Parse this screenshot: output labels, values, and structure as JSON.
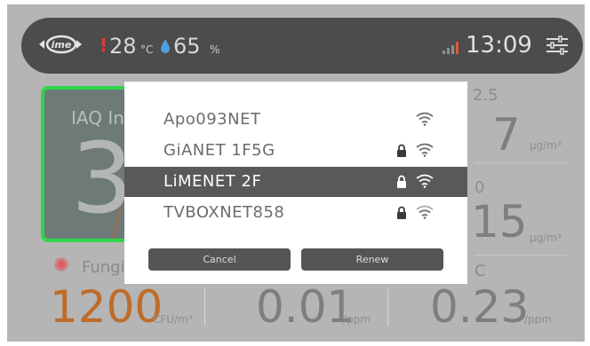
{
  "status_bar": {
    "logo_text": "ime",
    "temperature": "28",
    "temperature_unit": "°C",
    "humidity": "65",
    "humidity_unit": "%",
    "time": "13:09",
    "icons": [
      "lime-logo",
      "thermometer-icon",
      "humidity-drop-icon",
      "signal-icon",
      "settings-sliders-icon"
    ]
  },
  "background": {
    "iaq": {
      "title": "IAQ In",
      "value": "3"
    },
    "pm": {
      "label": "2.5",
      "value": "7",
      "unit": "μg/m³"
    },
    "pm10": {
      "label": "0",
      "value": "15",
      "unit": "μg/m³"
    },
    "fungi": {
      "label": "Fungi",
      "value": "1200",
      "unit": "CFU/m³"
    },
    "formaldehyde": {
      "value": "0.01",
      "unit": "/ppm"
    },
    "tvoc": {
      "label": "C",
      "value": "0.23",
      "unit": "/ppm"
    }
  },
  "wifi_dialog": {
    "networks": [
      {
        "name": "Apo093NET",
        "locked": false,
        "selected": false
      },
      {
        "name": "GiANET 1F5G",
        "locked": true,
        "selected": false
      },
      {
        "name": "LiMENET 2F",
        "locked": true,
        "selected": true
      },
      {
        "name": "TVBOXNET858",
        "locked": true,
        "selected": false
      }
    ],
    "cancel_label": "Cancel",
    "renew_label": "Renew"
  },
  "colors": {
    "accent_green": "#2fd64b",
    "temp_red": "#e23b35",
    "humidity_blue": "#4a9fe0",
    "signal_red": "#e25a35",
    "fungi_orange": "#bf6c2a",
    "selected_row": "#595959"
  }
}
